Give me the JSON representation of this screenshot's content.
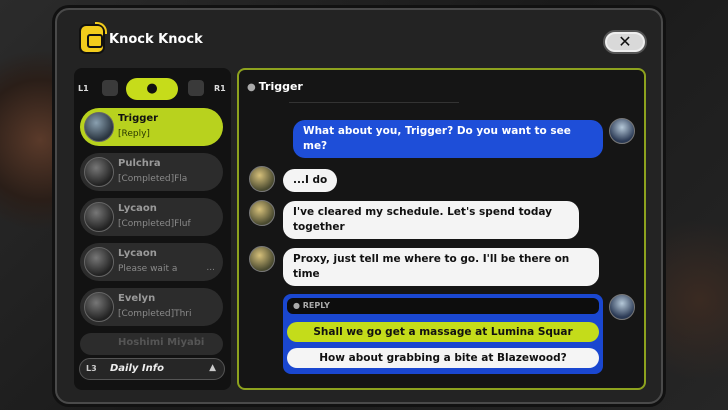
{
  "app": {
    "title": "Knock Knock",
    "close_label": "✕"
  },
  "left_panel": {
    "tab_left_key": "L1",
    "tab_right_key": "R1",
    "tab_active_icon": "person-icon",
    "contacts": [
      {
        "name": "Trigger",
        "subtitle": "[Reply]",
        "active": true
      },
      {
        "name": "Pulchra",
        "subtitle": "[Completed]Fla",
        "active": false
      },
      {
        "name": "Lycaon",
        "subtitle": "[Completed]Fluf",
        "active": false
      },
      {
        "name": "Lycaon",
        "subtitle": "Please wait a",
        "active": false
      },
      {
        "name": "Evelyn",
        "subtitle": "[Completed]Thri",
        "active": false
      },
      {
        "name": "Hoshimi Miyabi",
        "subtitle": "",
        "active": false
      }
    ],
    "daily_key": "L3",
    "daily_label": "Daily Info"
  },
  "chat": {
    "header": "Trigger",
    "messages": [
      {
        "from": "me",
        "text": "What about you, Trigger? Do you want to see me?"
      },
      {
        "from": "them",
        "text": "...I do"
      },
      {
        "from": "them",
        "text": "I've cleared my schedule. Let's spend today together"
      },
      {
        "from": "them",
        "text": "Proxy, just tell me where to go. I'll be there on time"
      }
    ],
    "reply": {
      "label": "REPLY",
      "options": [
        "Shall we go get a massage at Lumina Squar",
        "How about grabbing a bite at Blazewood?"
      ]
    }
  },
  "colors": {
    "accent": "#c4dc1a",
    "outgoing_bubble": "#1e4ed8",
    "incoming_bubble": "#f4f4f4"
  }
}
